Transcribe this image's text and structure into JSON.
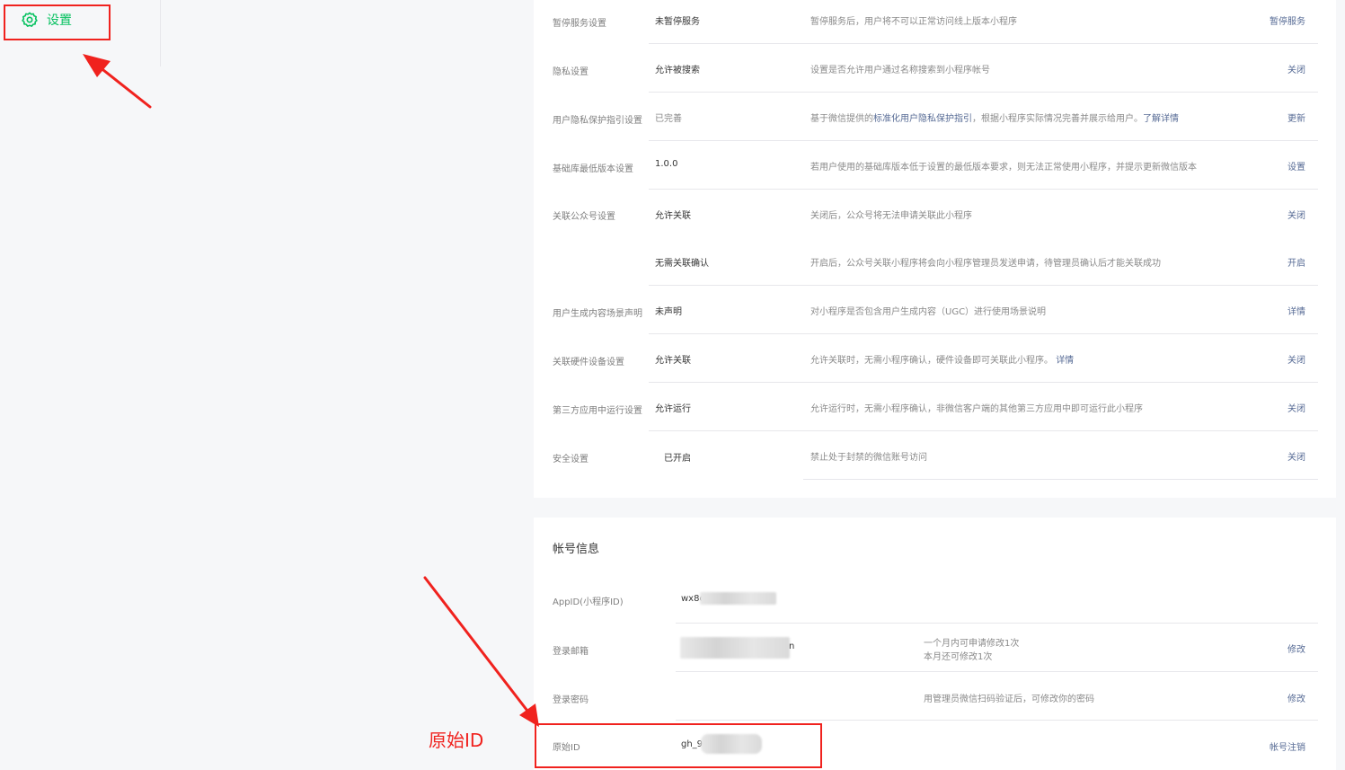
{
  "sidebar": {
    "settings_label": "设置"
  },
  "settings": {
    "rows": [
      {
        "label": "暂停服务设置",
        "value": "未暂停服务",
        "desc": "暂停服务后，用户将不可以正常访问线上版本小程序",
        "action": "暂停服务"
      },
      {
        "label": "隐私设置",
        "value": "允许被搜索",
        "desc": "设置是否允许用户通过名称搜索到小程序帐号",
        "action": "关闭"
      },
      {
        "label": "用户隐私保护指引设置",
        "value": "已完善",
        "desc_pre": "基于微信提供的",
        "desc_link": "标准化用户隐私保护指引",
        "desc_post": "，根据小程序实际情况完善并展示给用户。",
        "desc_link2": "了解详情",
        "action": "更新"
      },
      {
        "label": "基础库最低版本设置",
        "value": "1.0.0",
        "desc": "若用户使用的基础库版本低于设置的最低版本要求，则无法正常使用小程序，并提示更新微信版本",
        "action": "设置"
      },
      {
        "label": "关联公众号设置",
        "value": "允许关联",
        "desc": "关闭后，公众号将无法申请关联此小程序",
        "action": "关闭"
      },
      {
        "label": "",
        "value": "无需关联确认",
        "desc": "开启后，公众号关联小程序将会向小程序管理员发送申请，待管理员确认后才能关联成功",
        "action": "开启"
      },
      {
        "label": "用户生成内容场景声明",
        "value": "未声明",
        "desc": "对小程序是否包含用户生成内容（UGC）进行使用场景说明",
        "action": "详情"
      },
      {
        "label": "关联硬件设备设置",
        "value": "允许关联",
        "desc_pre": "允许关联时，无需小程序确认，硬件设备即可关联此小程序。",
        "desc_link": "详情",
        "action": "关闭"
      },
      {
        "label": "第三方应用中运行设置",
        "value": "允许运行",
        "desc": "允许运行时，无需小程序确认，非微信客户端的其他第三方应用中即可运行此小程序",
        "action": "关闭"
      },
      {
        "label": "安全设置",
        "value": "已开启",
        "desc": "禁止处于封禁的微信账号访问",
        "action": "关闭"
      }
    ]
  },
  "account": {
    "title": "帐号信息",
    "rows": [
      {
        "label": "AppID(小程序ID)",
        "value": "wx8c",
        "desc": "",
        "action": ""
      },
      {
        "label": "登录邮箱",
        "value": "n",
        "desc1": "一个月内可申请修改1次",
        "desc2": "本月还可修改1次",
        "action": "修改"
      },
      {
        "label": "登录密码",
        "value": "",
        "desc": "用管理员微信扫码验证后，可修改你的密码",
        "action": "修改"
      },
      {
        "label": "原始ID",
        "value": "gh_9",
        "desc": "",
        "action": "帐号注销"
      }
    ]
  },
  "annotation": {
    "label": "原始ID",
    "color": "#f0221e"
  },
  "colors": {
    "brand_green": "#07c160",
    "link_blue": "#576b95"
  }
}
